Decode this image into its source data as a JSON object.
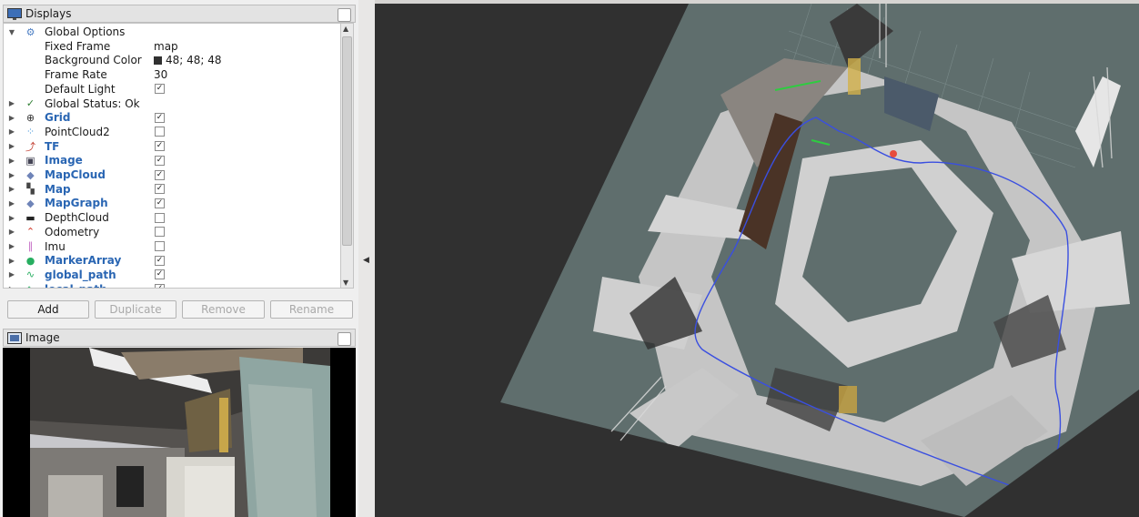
{
  "displays_panel": {
    "title": "Displays",
    "rows": [
      {
        "label": "Global Options",
        "kind": "group",
        "icon": "gear-icon"
      },
      {
        "label": "Fixed Frame",
        "value": "map",
        "kind": "prop"
      },
      {
        "label": "Background Color",
        "value": "48; 48; 48",
        "kind": "color",
        "color": "#303030"
      },
      {
        "label": "Frame Rate",
        "value": "30",
        "kind": "prop"
      },
      {
        "label": "Default Light",
        "checked": true,
        "kind": "propcheck"
      },
      {
        "label": "Global Status: Ok",
        "kind": "status",
        "icon": "checkmark-icon"
      },
      {
        "label": "Grid",
        "checked": true,
        "bold": true,
        "icon": "grid-icon"
      },
      {
        "label": "PointCloud2",
        "checked": false,
        "bold": false,
        "icon": "pointcloud-icon"
      },
      {
        "label": "TF",
        "checked": true,
        "bold": true,
        "icon": "tf-icon"
      },
      {
        "label": "Image",
        "checked": true,
        "bold": true,
        "icon": "image-icon"
      },
      {
        "label": "MapCloud",
        "checked": true,
        "bold": true,
        "icon": "diamond-icon"
      },
      {
        "label": "Map",
        "checked": true,
        "bold": true,
        "icon": "map-icon"
      },
      {
        "label": "MapGraph",
        "checked": true,
        "bold": true,
        "icon": "diamond-icon"
      },
      {
        "label": "DepthCloud",
        "checked": false,
        "bold": false,
        "icon": "depthcloud-icon"
      },
      {
        "label": "Odometry",
        "checked": false,
        "bold": false,
        "icon": "odometry-icon"
      },
      {
        "label": "Imu",
        "checked": false,
        "bold": false,
        "icon": "imu-icon"
      },
      {
        "label": "MarkerArray",
        "checked": true,
        "bold": true,
        "icon": "marker-icon"
      },
      {
        "label": "global_path",
        "checked": true,
        "bold": true,
        "icon": "path-icon"
      },
      {
        "label": "local_path",
        "checked": true,
        "bold": true,
        "icon": "path-icon"
      }
    ]
  },
  "buttons": {
    "add": "Add",
    "duplicate": "Duplicate",
    "remove": "Remove",
    "rename": "Rename"
  },
  "image_panel": {
    "title": "Image"
  },
  "colors": {
    "viewport_background": "#303030",
    "grid_plane": "#5f6e6d",
    "link": "#2a66b3",
    "path": "#3a4fe0"
  }
}
